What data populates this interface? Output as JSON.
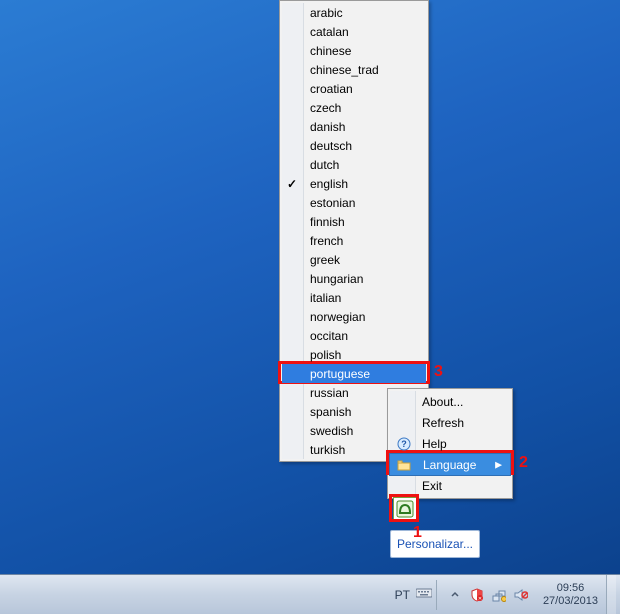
{
  "context_menu": {
    "items": [
      {
        "label": "About...",
        "icon": null
      },
      {
        "label": "Refresh",
        "icon": null
      },
      {
        "label": "Help",
        "icon": "help-icon"
      },
      {
        "label": "Language",
        "icon": "folder-icon",
        "submenu": true,
        "highlighted": true
      },
      {
        "label": "Exit",
        "icon": null
      }
    ]
  },
  "languages": {
    "items": [
      {
        "label": "arabic"
      },
      {
        "label": "catalan"
      },
      {
        "label": "chinese"
      },
      {
        "label": "chinese_trad"
      },
      {
        "label": "croatian"
      },
      {
        "label": "czech"
      },
      {
        "label": "danish"
      },
      {
        "label": "deutsch"
      },
      {
        "label": "dutch"
      },
      {
        "label": "english",
        "checked": true
      },
      {
        "label": "estonian"
      },
      {
        "label": "finnish"
      },
      {
        "label": "french"
      },
      {
        "label": "greek"
      },
      {
        "label": "hungarian"
      },
      {
        "label": "italian"
      },
      {
        "label": "norwegian"
      },
      {
        "label": "occitan"
      },
      {
        "label": "polish"
      },
      {
        "label": "portuguese",
        "highlighted": true
      },
      {
        "label": "russian"
      },
      {
        "label": "spanish"
      },
      {
        "label": "swedish"
      },
      {
        "label": "turkish"
      }
    ]
  },
  "personalize": {
    "label": "Personalizar..."
  },
  "annotations": {
    "one": "1",
    "two": "2",
    "three": "3"
  },
  "taskbar": {
    "lang_indicator": "PT",
    "time": "09:56",
    "date": "27/03/2013"
  }
}
